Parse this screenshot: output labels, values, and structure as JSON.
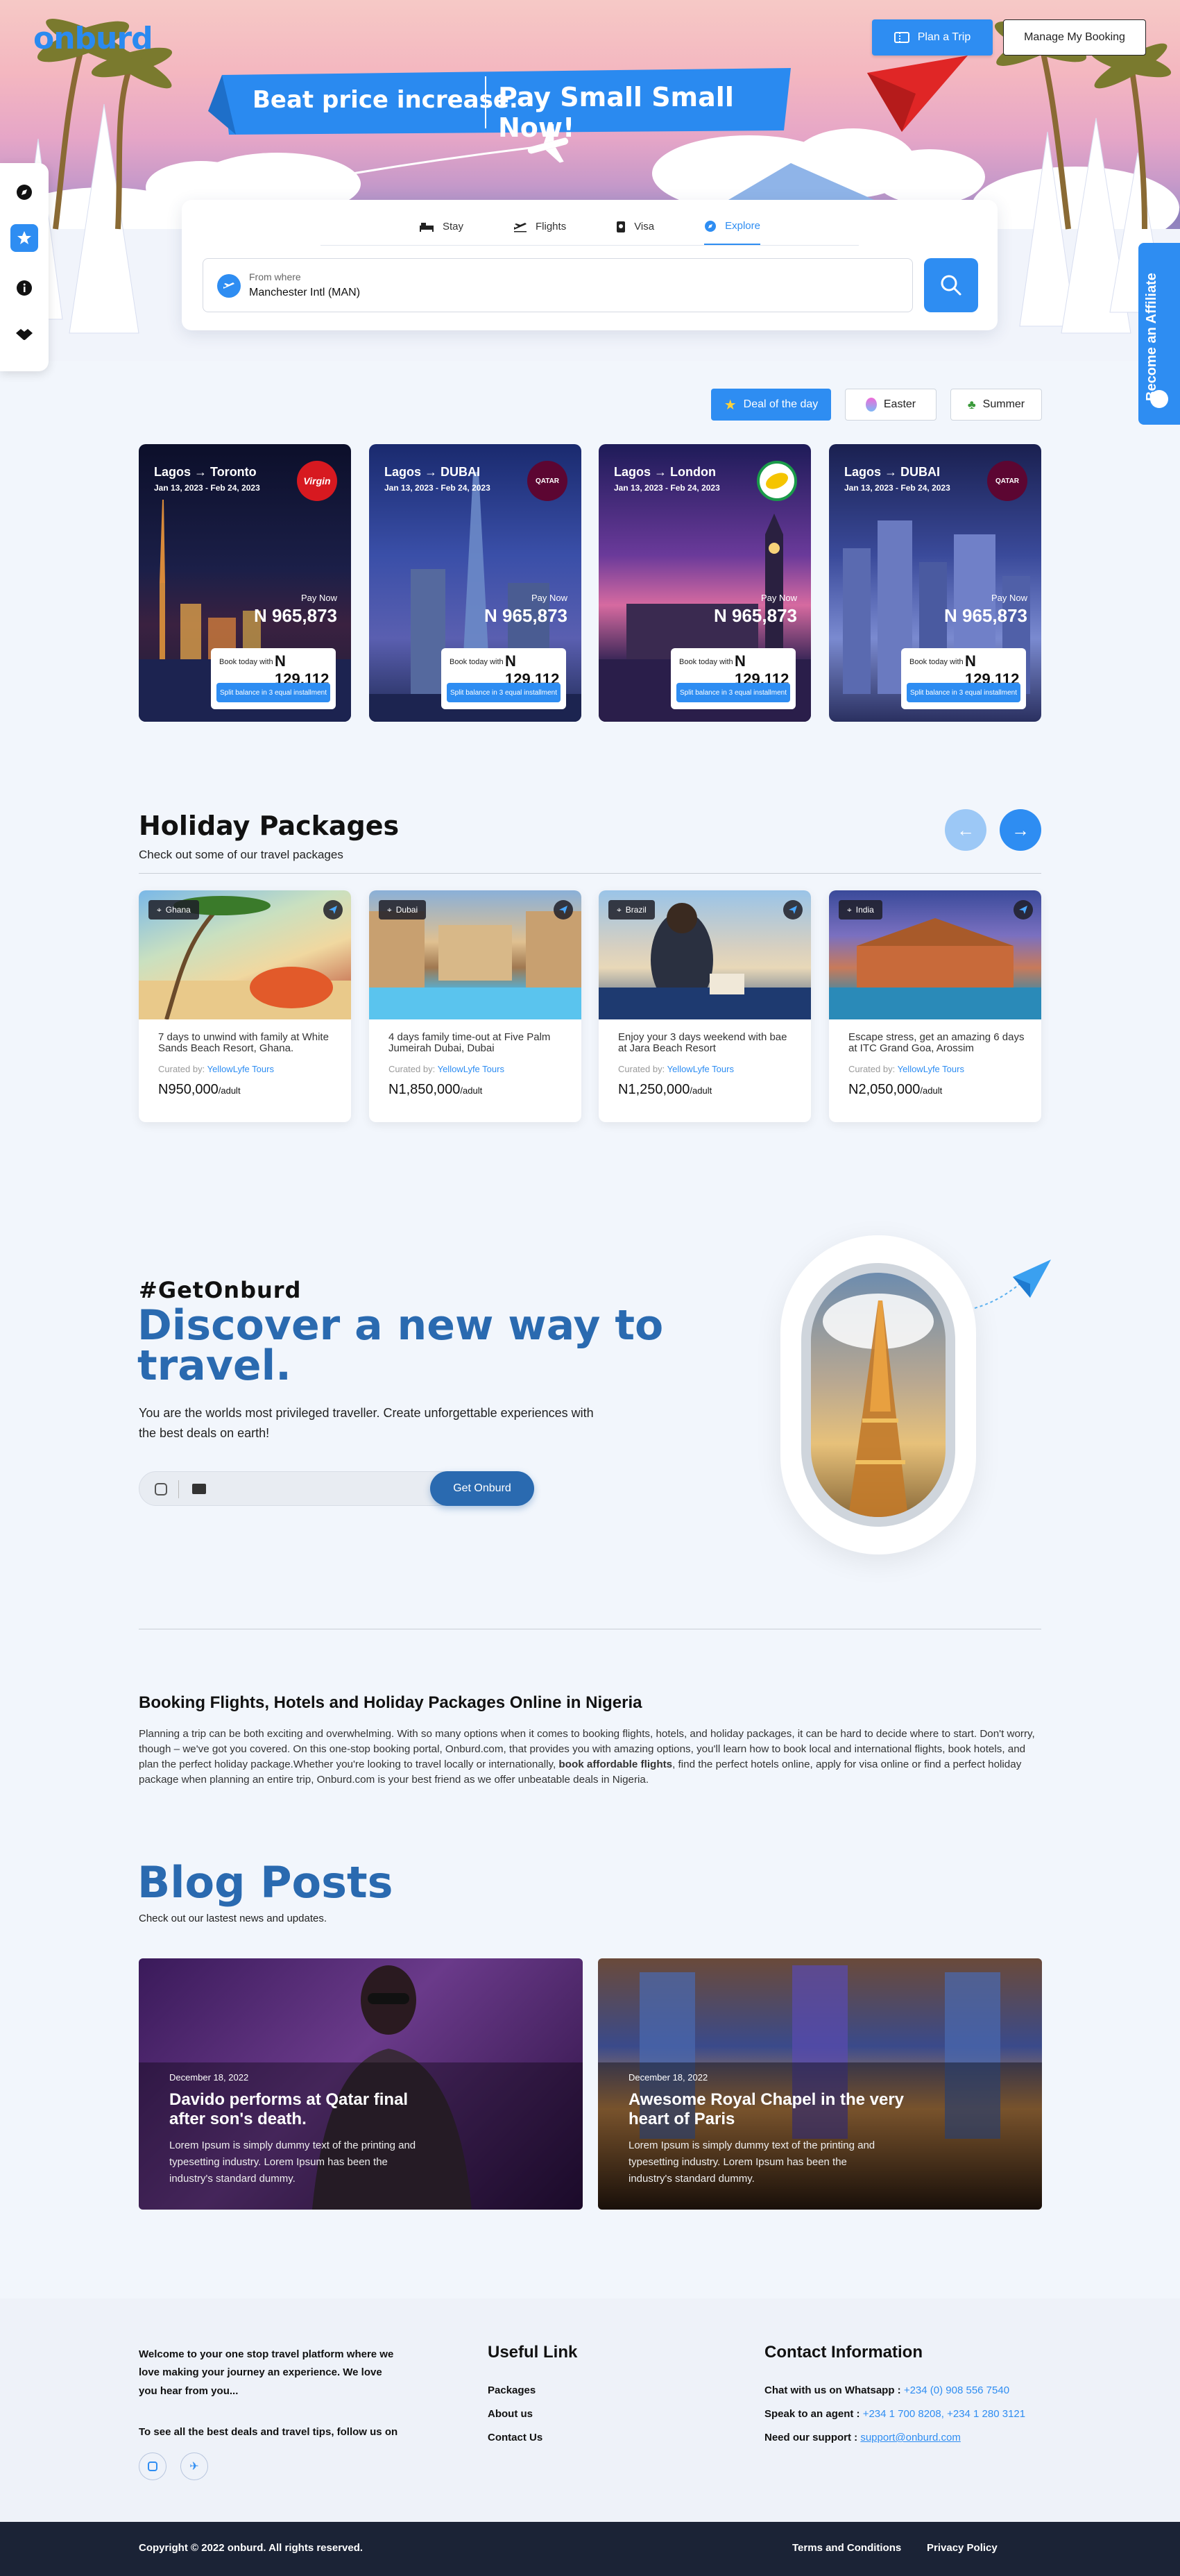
{
  "header": {
    "logo": "onburd",
    "plan_trip": "Plan a Trip",
    "manage_booking": "Manage My Booking"
  },
  "banner": {
    "part1": "Beat price increase.",
    "part2": "Pay Small Small Now!"
  },
  "affiliate": {
    "label": "Become an Affiliate"
  },
  "search": {
    "tabs": [
      {
        "label": "Stay",
        "icon": "bed-icon"
      },
      {
        "label": "Flights",
        "icon": "plane-icon"
      },
      {
        "label": "Visa",
        "icon": "passport-icon"
      },
      {
        "label": "Explore",
        "icon": "compass-icon"
      }
    ],
    "from_label": "From where",
    "from_value": "Manchester Intl (MAN)"
  },
  "filters": [
    {
      "label": "Deal of the day",
      "icon": "star-icon"
    },
    {
      "label": "Easter",
      "icon": "egg-icon"
    },
    {
      "label": "Summer",
      "icon": "palm-icon"
    }
  ],
  "deals": [
    {
      "from": "Lagos",
      "to": "Toronto",
      "dates": "Jan 13, 2023 - Feb 24, 2023",
      "airline": "Virgin",
      "pay_now": "Pay Now",
      "price": "N 965,873",
      "book_label": "Book today with",
      "book_price": "N 129,112",
      "split": "Split balance in 3 equal installment"
    },
    {
      "from": "Lagos",
      "to": "DUBAI",
      "dates": "Jan 13, 2023 - Feb 24, 2023",
      "airline": "QATAR",
      "pay_now": "Pay Now",
      "price": "N 965,873",
      "book_label": "Book today with",
      "book_price": "N 129,112",
      "split": "Split balance in 3 equal installment"
    },
    {
      "from": "Lagos",
      "to": "London",
      "dates": "Jan 13, 2023 - Feb 24, 2023",
      "airline": "",
      "pay_now": "Pay Now",
      "price": "N 965,873",
      "book_label": "Book today with",
      "book_price": "N 129,112",
      "split": "Split balance in 3 equal installment"
    },
    {
      "from": "Lagos",
      "to": "DUBAI",
      "dates": "Jan 13, 2023 - Feb 24, 2023",
      "airline": "QATAR",
      "pay_now": "Pay Now",
      "price": "N 965,873",
      "book_label": "Book today with",
      "book_price": "N 129,112",
      "split": "Split balance in 3 equal installment"
    }
  ],
  "holiday": {
    "title": "Holiday Packages",
    "subtitle": "Check out some of our travel packages",
    "curated_prefix": "Curated by: ",
    "packages": [
      {
        "location": "Ghana",
        "desc": "7 days to unwind with family at White Sands Beach Resort, Ghana.",
        "curator": "YellowLyfe Tours",
        "price": "N950,000",
        "unit": "/adult"
      },
      {
        "location": "Dubai",
        "desc": "4 days family time-out at Five Palm Jumeirah Dubai, Dubai",
        "curator": "YellowLyfe Tours",
        "price": "N1,850,000",
        "unit": "/adult"
      },
      {
        "location": "Brazil",
        "desc": "Enjoy your 3 days weekend with bae at Jara Beach Resort",
        "curator": "YellowLyfe Tours",
        "price": "N1,250,000",
        "unit": "/adult"
      },
      {
        "location": "India",
        "desc": "Escape stress, get an amazing 6 days at ITC Grand Goa, Arossim",
        "curator": "YellowLyfe Tours",
        "price": "N2,050,000",
        "unit": "/adult"
      }
    ]
  },
  "cta": {
    "hashtag": "#GetOnburd",
    "headline1": "Discover a new way to",
    "headline2": "travel.",
    "body": "You are the worlds most privileged traveller. Create unforgettable experiences with the best deals on earth!",
    "button": "Get Onburd"
  },
  "seo": {
    "title": "Booking Flights, Hotels and Holiday Packages Online in Nigeria",
    "text_a": "Planning a trip can be both exciting and overwhelming. With so many options when it comes to booking flights, hotels, and holiday packages, it can be hard to decide where to start. Don't worry, though – we've got you covered. On this one-stop booking portal, Onburd.com, that provides you with amazing options, you'll learn how to book local and international flights, book hotels, and plan the perfect holiday package.Whether you're looking to travel locally or internationally, ",
    "text_bold": "book affordable flights",
    "text_b": ", find the perfect hotels online, apply for visa online or find a perfect holiday package when planning an entire trip, Onburd.com is your best friend as we offer unbeatable deals in Nigeria."
  },
  "blog": {
    "title": "Blog Posts",
    "subtitle": "Check out our lastest news and updates.",
    "posts": [
      {
        "date": "December 18, 2022",
        "title": "Davido performs at Qatar final after son's death.",
        "body": "Lorem Ipsum is simply dummy text of the printing and typesetting industry. Lorem Ipsum has been the industry's standard dummy."
      },
      {
        "date": "December 18, 2022",
        "title": "Awesome Royal Chapel in the very heart of Paris",
        "body": "Lorem Ipsum is simply dummy text of the printing and typesetting industry. Lorem Ipsum has been the industry's standard dummy."
      }
    ]
  },
  "footer": {
    "welcome": "Welcome to your one stop travel platform where we love making your journey an experience. We love you hear from you...",
    "follow": "To see all the best deals and travel tips, follow us on",
    "useful_title": "Useful Link",
    "links": [
      "Packages",
      "About us",
      "Contact Us"
    ],
    "contact_title": "Contact Information",
    "whatsapp_label": "Chat with us on Whatsapp :",
    "whatsapp": "+234 (0) 908 556 7540",
    "agent_label": "Speak to an agent :",
    "agent": "+234 1 700 8208, +234 1 280 3121",
    "support_label": "Need our support :",
    "support": "support@onburd.com",
    "copyright": "Copyright © 2022 onburd. All rights reserved.",
    "terms": "Terms and Conditions",
    "privacy": "Privacy Policy"
  }
}
